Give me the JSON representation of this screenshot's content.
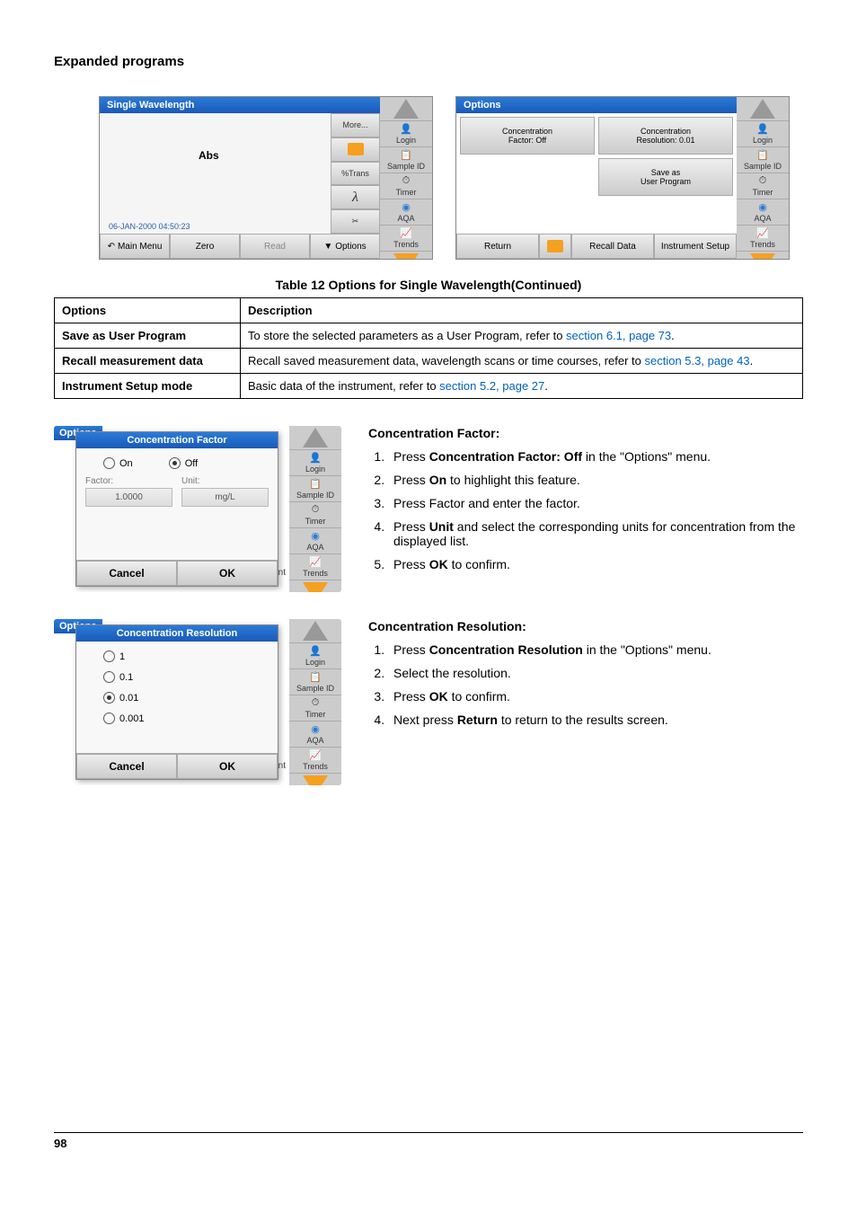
{
  "section_title": "Expanded programs",
  "screenshot1": {
    "title": "Single Wavelength",
    "abs": "Abs",
    "date": "06-JAN-2000  04:50:23",
    "btns": {
      "more": "More...",
      "folder": "",
      "trans": "%Trans",
      "lambda": "λ",
      "scissors": ""
    },
    "bottom": {
      "main": "Main Menu",
      "zero": "Zero",
      "read": "Read",
      "options": "Options"
    }
  },
  "screenshot2": {
    "title": "Options",
    "cells": {
      "c1a": "Concentration",
      "c1b": "Factor: Off",
      "c2a": "Concentration",
      "c2b": "Resolution: 0.01",
      "c3a": "",
      "c3b": "",
      "c4a": "Save as",
      "c4b": "User Program"
    },
    "bottom": {
      "return": "Return",
      "recall": "Recall Data",
      "setup": "Instrument Setup"
    }
  },
  "sidebar": {
    "login": "Login",
    "sample": "Sample ID",
    "timer": "Timer",
    "aqa": "AQA",
    "trends": "Trends"
  },
  "table": {
    "caption": "Table 12 Options for Single Wavelength(Continued)",
    "h1": "Options",
    "h2": "Description",
    "r1a": "Save as User Program",
    "r1b_pre": "To store the selected parameters as a User Program, refer to ",
    "r1b_link": "section 6.1, page 73",
    "r2a": "Recall measurement data",
    "r2b_pre": "Recall saved measurement data, wavelength scans or time courses, refer to ",
    "r2b_link": "section 5.3, page 43",
    "r3a": "Instrument Setup mode",
    "r3b_pre": "Basic data of the instrument, refer to ",
    "r3b_link": "section 5.2, page 27"
  },
  "dialog1": {
    "bg_title": "Options",
    "title": "Concentration Factor",
    "on": "On",
    "off": "Off",
    "factor_lbl": "Factor:",
    "unit_lbl": "Unit:",
    "factor_val": "1.0000",
    "unit_val": "mg/L",
    "cancel": "Cancel",
    "ok": "OK",
    "ent": "ent"
  },
  "dialog2": {
    "bg_title": "Options",
    "title": "Concentration Resolution",
    "o1": "1",
    "o2": "0.1",
    "o3": "0.01",
    "o4": "0.001",
    "cancel": "Cancel",
    "ok": "OK",
    "ent": "ent"
  },
  "text1": {
    "heading": "Concentration Factor:",
    "s1a": "Press ",
    "s1b": "Concentration Factor: Off",
    "s1c": " in the \"Options\" menu.",
    "s2a": "Press ",
    "s2b": "On",
    "s2c": " to highlight this feature.",
    "s3": "Press Factor and enter the factor.",
    "s4a": "Press ",
    "s4b": "Unit",
    "s4c": " and select the corresponding units for concentration from the displayed list.",
    "s5a": "Press ",
    "s5b": "OK",
    "s5c": " to confirm."
  },
  "text2": {
    "heading": "Concentration Resolution:",
    "s1a": "Press ",
    "s1b": "Concentration Resolution",
    "s1c": " in the \"Options\" menu.",
    "s2": "Select the resolution.",
    "s3a": "Press ",
    "s3b": "OK",
    "s3c": " to confirm.",
    "s4a": "Next press ",
    "s4b": "Return",
    "s4c": " to return to the results screen."
  },
  "page_number": "98"
}
